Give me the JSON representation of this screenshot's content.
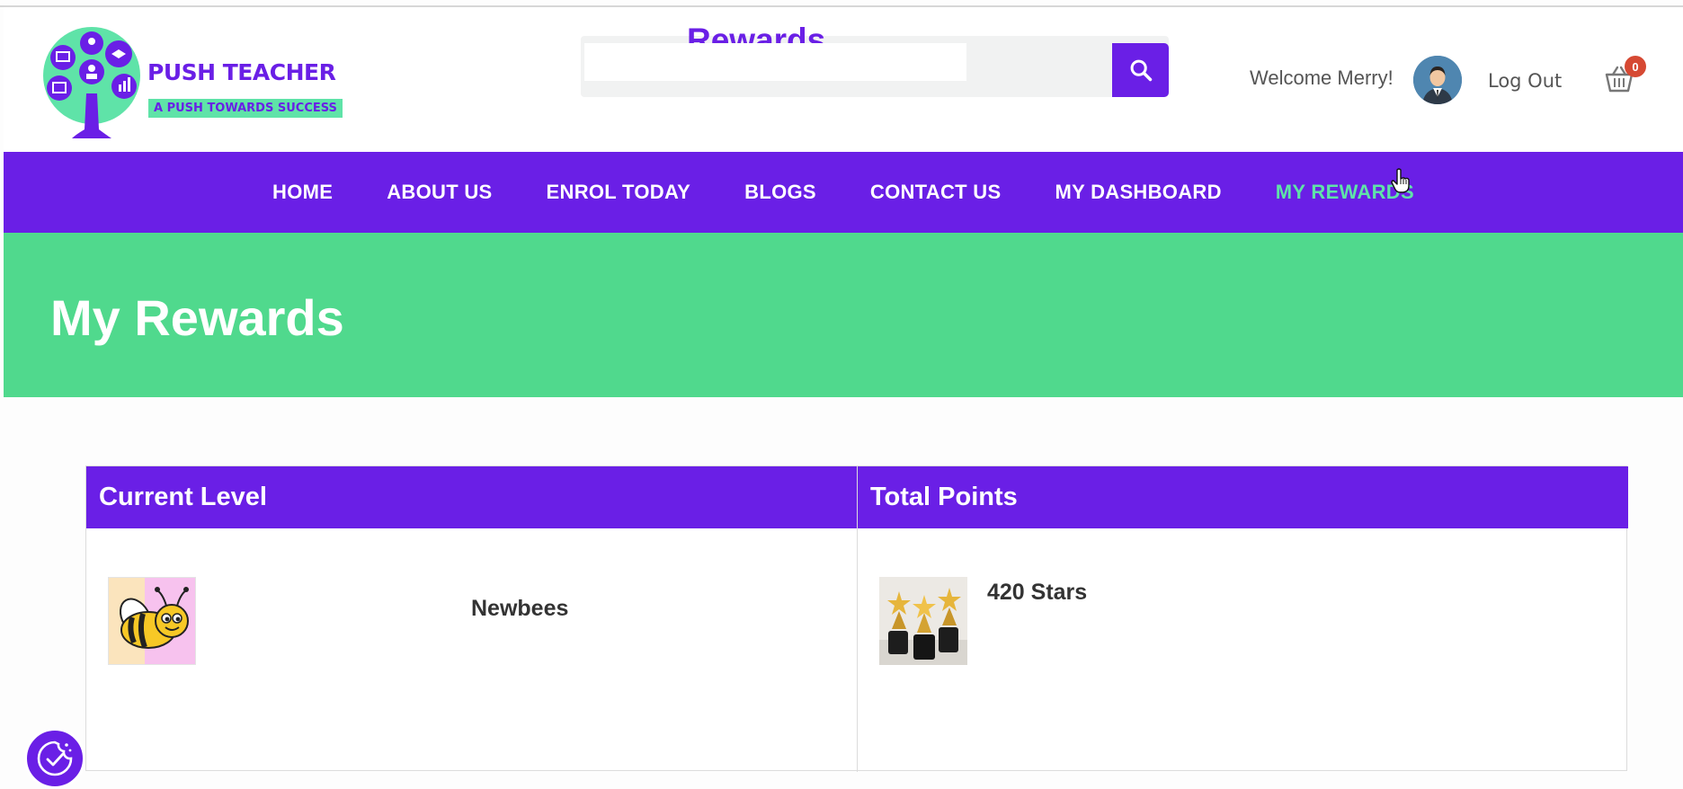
{
  "header": {
    "logo": {
      "title": "PUSH TEACHER",
      "tagline": "A PUSH TOWARDS SUCCESS"
    },
    "search": {
      "title": "Rewards",
      "value": "",
      "placeholder": ""
    },
    "welcome_text": "Welcome Merry!",
    "logout_label": "Log Out",
    "cart_count": "0"
  },
  "nav": {
    "items": [
      {
        "label": "HOME"
      },
      {
        "label": "ABOUT US"
      },
      {
        "label": "ENROL TODAY"
      },
      {
        "label": "BLOGS"
      },
      {
        "label": "CONTACT US"
      },
      {
        "label": "MY DASHBOARD"
      },
      {
        "label": "MY REWARDS",
        "active": true
      }
    ]
  },
  "banner": {
    "title": "My Rewards"
  },
  "rewards": {
    "headers": [
      "Current Level",
      "Total Points"
    ],
    "level_name": "Newbees",
    "points": "420 Stars"
  },
  "colors": {
    "brand_purple": "#6a1fe6",
    "brand_green": "#50d98d",
    "accent_mint": "#5fe3a8",
    "badge_red": "#d64933"
  }
}
